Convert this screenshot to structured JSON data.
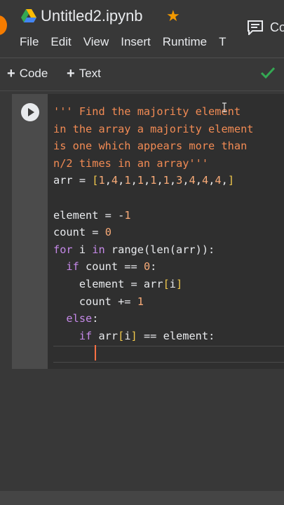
{
  "header": {
    "title": "Untitled2.ipynb",
    "comment_label": "Co"
  },
  "menu": [
    "File",
    "Edit",
    "View",
    "Insert",
    "Runtime",
    "T"
  ],
  "toolbar": {
    "add_code": "Code",
    "add_text": "Text"
  },
  "cell": {
    "lines": [
      "''' Find the majority element",
      "in the array a majority element",
      "is one which appears more than",
      "n/2 times in an array'''",
      "arr = [1,4,1,1,1,1,3,4,4,4,]",
      "",
      "element = -1",
      "count = 0",
      "for i in range(len(arr)):",
      "  if count == 0:",
      "    element = arr[i]",
      "    count += 1",
      "  else:",
      "    if arr[i] == element:"
    ]
  },
  "colors": {
    "string": "#f28b54",
    "keyword": "#c589e8",
    "number": "#f9ab78",
    "bracket": "#f2c94c",
    "accent_check": "#34a853",
    "star": "#f29900"
  },
  "icons": [
    "drive-icon",
    "star-icon",
    "comment-icon",
    "check-icon",
    "run-cell-icon"
  ]
}
